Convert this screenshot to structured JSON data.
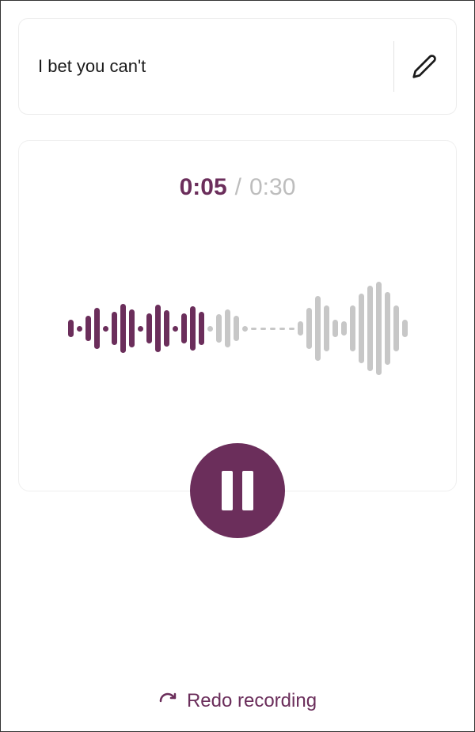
{
  "title": {
    "text": "I bet you can't"
  },
  "timer": {
    "current": "0:05",
    "separator": "/",
    "total": "0:30"
  },
  "redo": {
    "label": "Redo recording"
  },
  "colors": {
    "accent": "#6b2e5b",
    "muted": "#c7c7c7"
  },
  "waveform": {
    "played": [
      22,
      8,
      32,
      52,
      8,
      42,
      62,
      48,
      8,
      38,
      60,
      46,
      8,
      38,
      56,
      42
    ],
    "current_gray": [
      8,
      36,
      48,
      32,
      8
    ],
    "dashes": 5,
    "upcoming_gray": [
      18,
      52,
      82,
      58,
      22,
      18,
      58,
      88,
      108,
      118,
      92,
      58,
      22
    ]
  }
}
